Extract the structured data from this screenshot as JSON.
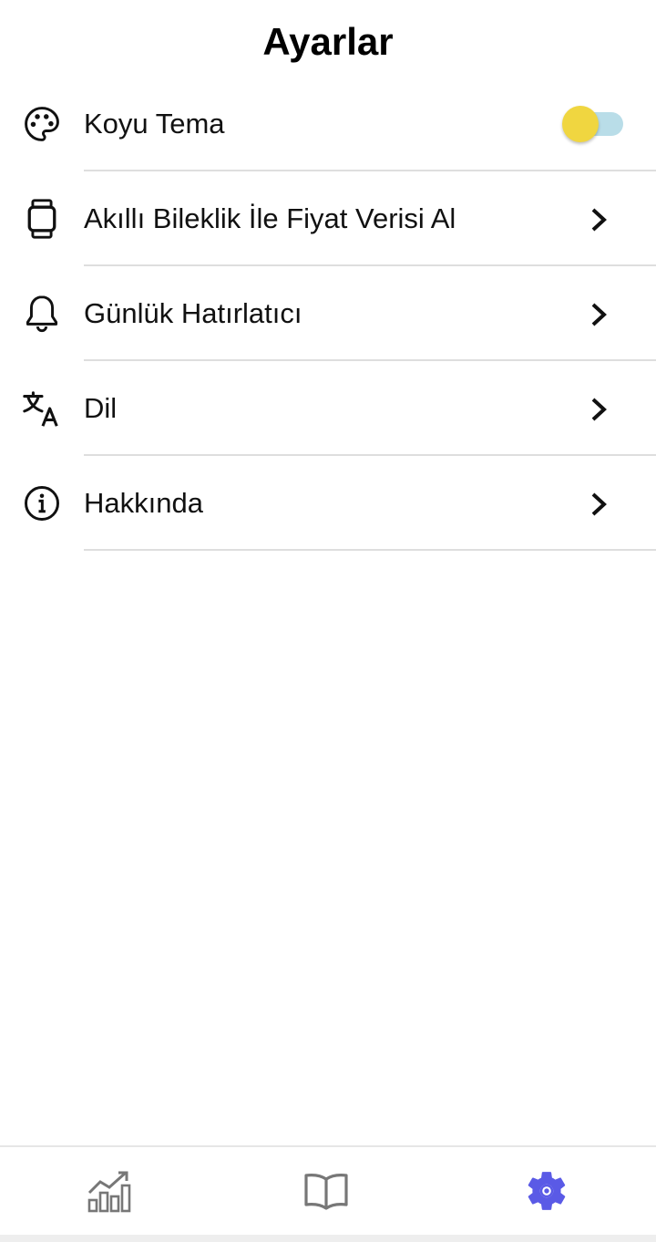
{
  "header": {
    "title": "Ayarlar"
  },
  "settings": {
    "items": [
      {
        "label": "Koyu Tema",
        "icon": "palette-icon",
        "control": "toggle",
        "toggle_on": false
      },
      {
        "label": "Akıllı Bileklik İle Fiyat Verisi Al",
        "icon": "smartwatch-icon",
        "control": "chevron"
      },
      {
        "label": "Günlük Hatırlatıcı",
        "icon": "bell-icon",
        "control": "chevron"
      },
      {
        "label": "Dil",
        "icon": "translate-icon",
        "control": "chevron"
      },
      {
        "label": "Hakkında",
        "icon": "info-icon",
        "control": "chevron"
      }
    ]
  },
  "toggle_colors": {
    "thumb": "#f0d640",
    "track": "#b9dde8"
  },
  "bottom_nav": {
    "items": [
      {
        "icon": "chart-icon",
        "active": false
      },
      {
        "icon": "book-icon",
        "active": false
      },
      {
        "icon": "gear-icon",
        "active": true
      }
    ],
    "active_color": "#5a5ae6",
    "inactive_color": "#777777"
  }
}
